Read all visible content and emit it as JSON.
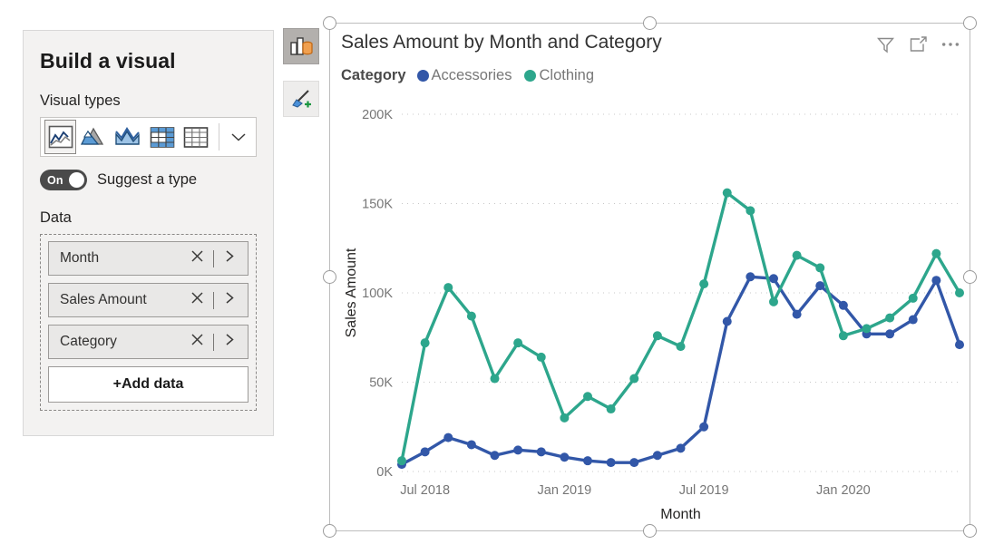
{
  "build_pane": {
    "title": "Build a visual",
    "visual_types_label": "Visual types",
    "visual_types": [
      {
        "name": "line-chart-icon",
        "selected": true
      },
      {
        "name": "area-chart-icon",
        "selected": false
      },
      {
        "name": "line-and-area-chart-icon",
        "selected": false
      },
      {
        "name": "matrix-icon",
        "selected": false
      },
      {
        "name": "table-icon",
        "selected": false
      }
    ],
    "expand_icon": "chevron-down-icon",
    "suggest": {
      "state": "On",
      "label": "Suggest a type"
    },
    "data_label": "Data",
    "fields": [
      {
        "name": "Month",
        "remove_icon": "close-icon",
        "expand_icon": "chevron-right-icon"
      },
      {
        "name": "Sales Amount",
        "remove_icon": "close-icon",
        "expand_icon": "chevron-right-icon"
      },
      {
        "name": "Category",
        "remove_icon": "close-icon",
        "expand_icon": "chevron-right-icon"
      }
    ],
    "add_data_label": "+Add data"
  },
  "tools": [
    {
      "name": "build-visual-tool",
      "icon": "chart-and-data-icon",
      "selected": true
    },
    {
      "name": "format-visual-tool",
      "icon": "paintbrush-plus-icon",
      "selected": false
    }
  ],
  "visual": {
    "title": "Sales Amount by Month and Category",
    "header_icons": [
      {
        "name": "filter-icon",
        "label": "Filters"
      },
      {
        "name": "focus-mode-icon",
        "label": "Focus mode"
      },
      {
        "name": "more-options-icon",
        "label": "More options"
      }
    ]
  },
  "chart_data": {
    "type": "line",
    "title": "Sales Amount by Month and Category",
    "xlabel": "Month",
    "ylabel": "Sales Amount",
    "legend_title": "Category",
    "legend_position": "top-left",
    "grid": true,
    "ylim": [
      0,
      200000
    ],
    "yticks": [
      0,
      50000,
      100000,
      150000,
      200000
    ],
    "ytick_labels": [
      "0K",
      "50K",
      "100K",
      "150K",
      "200K"
    ],
    "xtick_labels": [
      "Jul 2018",
      "Jan 2019",
      "Jul 2019",
      "Jan 2020"
    ],
    "xtick_indices": [
      1,
      7,
      13,
      19
    ],
    "x": [
      "Jun 2018",
      "Jul 2018",
      "Aug 2018",
      "Sep 2018",
      "Oct 2018",
      "Nov 2018",
      "Dec 2018",
      "Jan 2019",
      "Feb 2019",
      "Mar 2019",
      "Apr 2019",
      "May 2019",
      "Jun 2019",
      "Jul 2019",
      "Aug 2019",
      "Sep 2019",
      "Oct 2019",
      "Nov 2019",
      "Dec 2019",
      "Jan 2020",
      "Feb 2020",
      "Mar 2020",
      "Apr 2020",
      "May 2020",
      "Jun 2020"
    ],
    "series": [
      {
        "name": "Accessories",
        "color": "#3257A8",
        "values": [
          4000,
          11000,
          19000,
          15000,
          9000,
          12000,
          11000,
          8000,
          6000,
          5000,
          5000,
          9000,
          13000,
          25000,
          84000,
          109000,
          108000,
          88000,
          104000,
          93000,
          77000,
          77000,
          85000,
          107000,
          71000
        ]
      },
      {
        "name": "Clothing",
        "color": "#2DA68C",
        "values": [
          6000,
          72000,
          103000,
          87000,
          52000,
          72000,
          64000,
          30000,
          42000,
          35000,
          52000,
          76000,
          70000,
          105000,
          156000,
          146000,
          95000,
          121000,
          114000,
          76000,
          80000,
          86000,
          97000,
          122000,
          100000
        ]
      }
    ]
  }
}
